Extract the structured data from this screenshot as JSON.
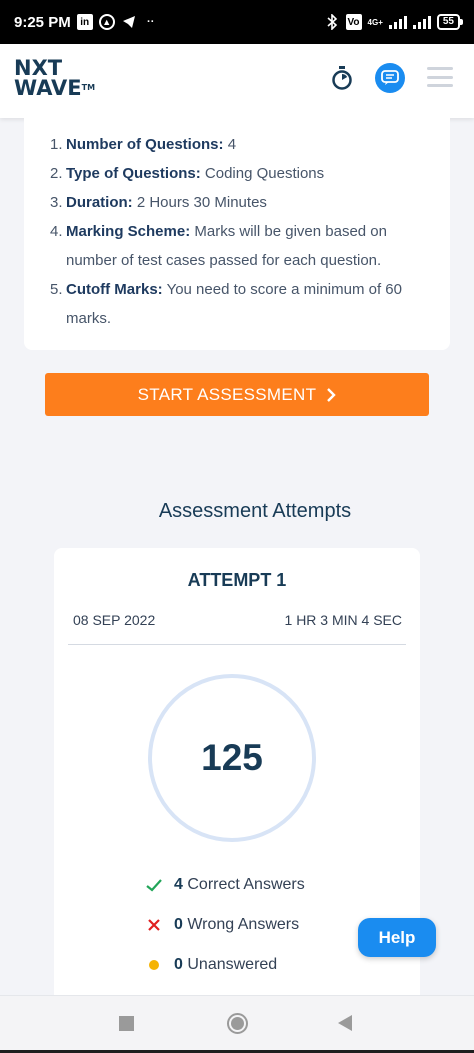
{
  "status_bar": {
    "time": "9:25 PM",
    "icons": [
      "linkedin-icon",
      "app-icon",
      "telegram-icon",
      "more-icon",
      "bluetooth-icon",
      "volte-icon",
      "signal-icon",
      "battery-icon"
    ],
    "network": "4G+",
    "battery": "55"
  },
  "header": {
    "logo_line1": "NXT",
    "logo_line2": "WAVE",
    "logo_tm": "TM",
    "icons": [
      "timer-icon",
      "chat-icon",
      "menu-icon"
    ]
  },
  "instructions": [
    {
      "num": "1.",
      "label": "Number of Questions:",
      "text": "4"
    },
    {
      "num": "2.",
      "label": "Type of Questions:",
      "text": "Coding Questions"
    },
    {
      "num": "3.",
      "label": "Duration:",
      "text": "2 Hours 30 Minutes"
    },
    {
      "num": "4.",
      "label": "Marking Scheme:",
      "text": "Marks will be given based on number of test cases passed for each question."
    },
    {
      "num": "5.",
      "label": "Cutoff Marks:",
      "text": "You need to score a minimum of 60 marks."
    }
  ],
  "start_button": {
    "label": "START ASSESSMENT",
    "icon": "chevron-right-icon"
  },
  "attempts": {
    "title": "Assessment Attempts",
    "attempt": {
      "name": "ATTEMPT 1",
      "date": "08 SEP 2022",
      "duration": "1 HR 3 MIN 4 SEC",
      "score": "125",
      "results": [
        {
          "icon": "check-icon",
          "count": "4",
          "label": "Correct Answers",
          "color": "#22a559"
        },
        {
          "icon": "cross-icon",
          "count": "0",
          "label": "Wrong Answers",
          "color": "#e02020"
        },
        {
          "icon": "dot-icon",
          "count": "0",
          "label": "Unanswered",
          "color": "#f5b302"
        }
      ]
    }
  },
  "help_button": {
    "label": "Help"
  },
  "colors": {
    "accent": "#fd7e1c",
    "primary": "#183b56",
    "help": "#1a8cf0"
  }
}
